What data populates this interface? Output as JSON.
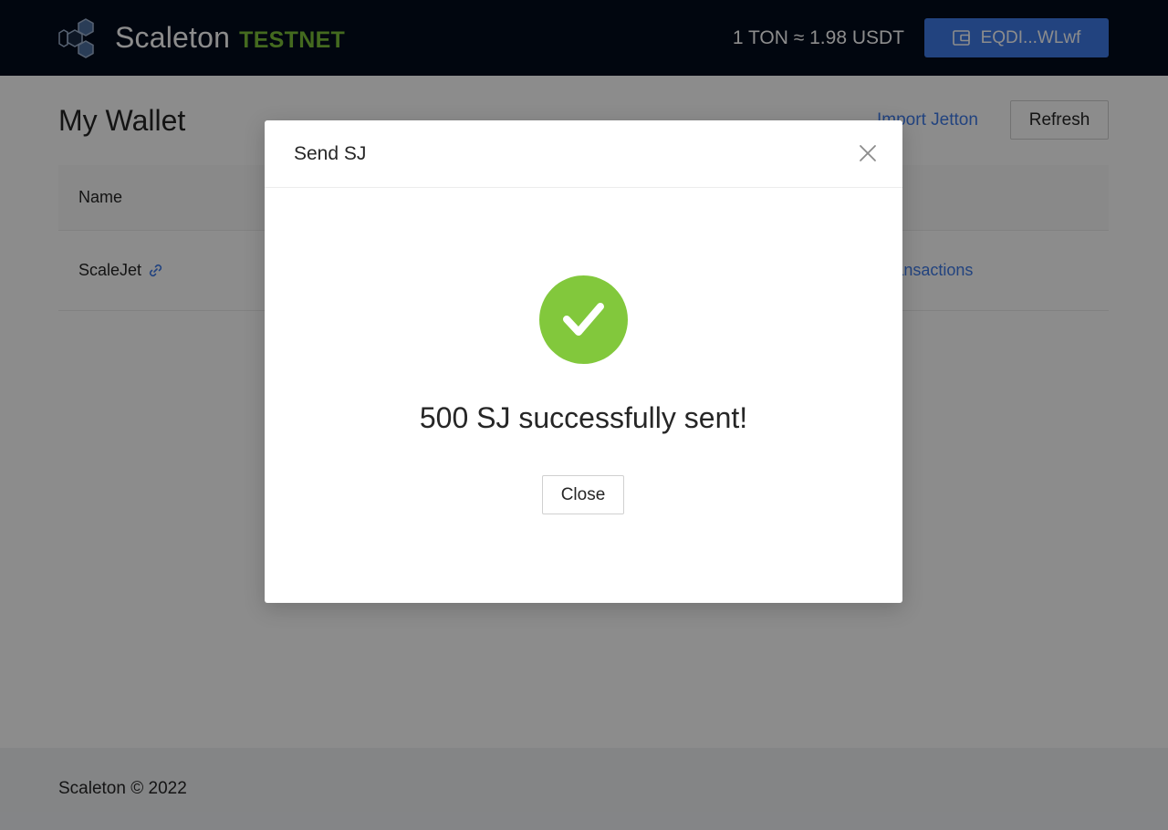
{
  "header": {
    "brand": "Scaleton",
    "brand_tag": "TESTNET",
    "rate": "1 TON ≈ 1.98 USDT",
    "wallet_address": "EQDI...WLwf",
    "logo_icon": "hexagon-cluster-icon",
    "wallet_icon": "wallet-icon"
  },
  "main": {
    "title": "My Wallet",
    "import_label": "Import Jetton",
    "refresh_label": "Refresh",
    "table": {
      "columns": [
        "Name"
      ],
      "rows": [
        {
          "name": "ScaleJet",
          "action": "Transactions",
          "name_icon": "link-icon"
        }
      ]
    }
  },
  "footer": {
    "text": "Scaleton © 2022"
  },
  "modal": {
    "title": "Send SJ",
    "message": "500 SJ successfully sent!",
    "close_label": "Close",
    "close_icon": "close-icon",
    "status_icon": "check-circle-icon"
  },
  "colors": {
    "header_bg": "#020b1d",
    "accent_blue": "#3f7be8",
    "testnet_green": "#7cc13a",
    "success_green": "#82c83c"
  }
}
